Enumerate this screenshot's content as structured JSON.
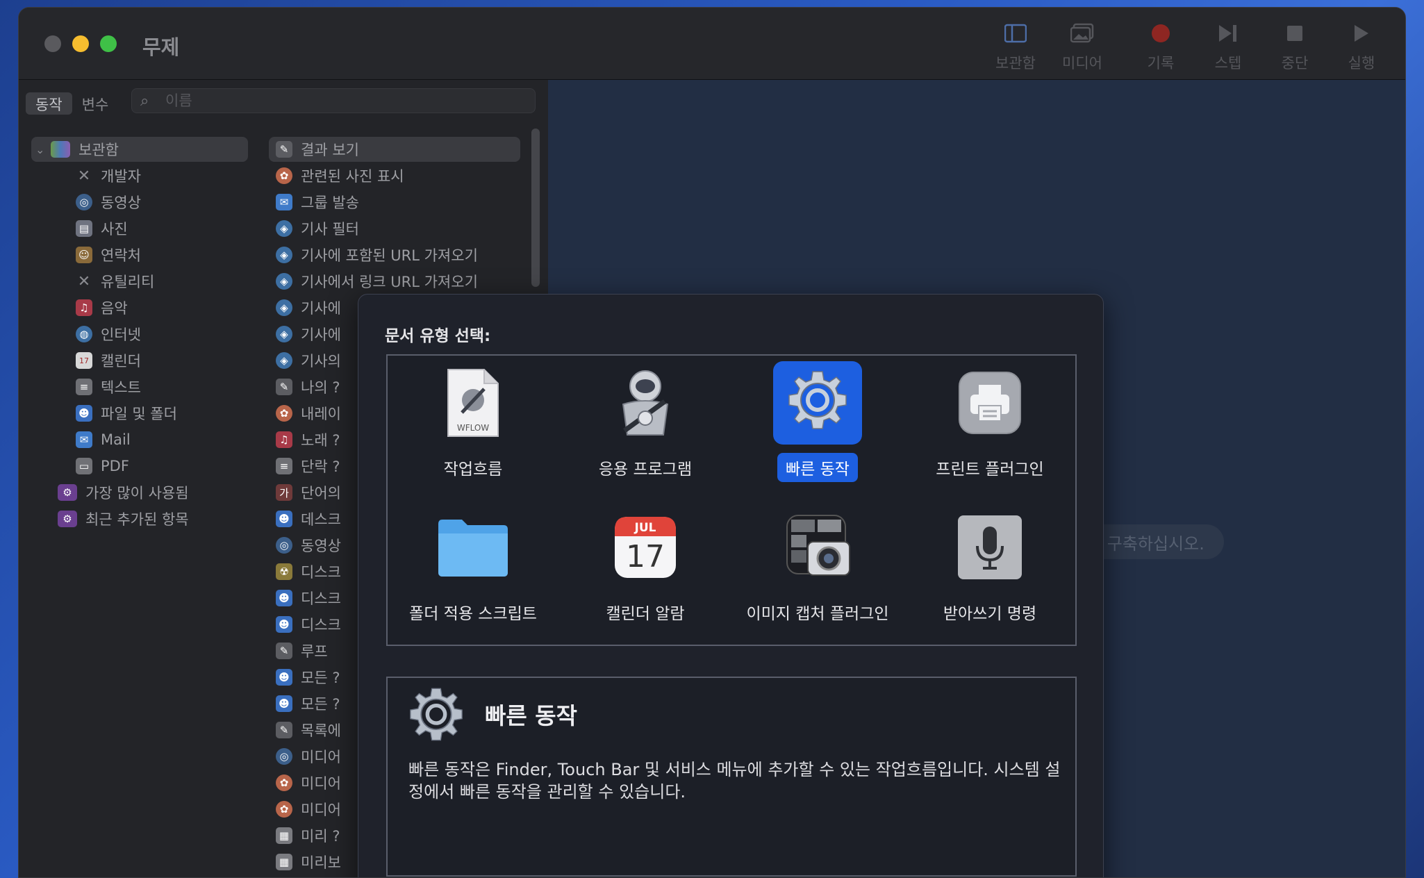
{
  "window": {
    "title": "무제"
  },
  "toolbar": {
    "items": [
      {
        "label": "보관함",
        "icon": "sidebar-icon"
      },
      {
        "label": "미디어",
        "icon": "photo-icon"
      },
      {
        "label": "기록",
        "icon": "record-icon"
      },
      {
        "label": "스텝",
        "icon": "step-icon"
      },
      {
        "label": "중단",
        "icon": "stop-icon"
      },
      {
        "label": "실행",
        "icon": "play-icon"
      }
    ]
  },
  "tabs": {
    "actions": "동작",
    "variables": "변수"
  },
  "search": {
    "placeholder": "이름",
    "value": ""
  },
  "library": {
    "root": "보관함",
    "items": [
      "개발자",
      "동영상",
      "사진",
      "연락처",
      "유틸리티",
      "음악",
      "인터넷",
      "캘린더",
      "텍스트",
      "파일 및 폴더",
      "Mail",
      "PDF"
    ],
    "most_used": "가장 많이 사용됨",
    "recently_added": "최근 추가된 항목"
  },
  "actions": [
    "결과 보기",
    "관련된 사진 표시",
    "그룹 발송",
    "기사 필터",
    "기사에 포함된 URL 가져오기",
    "기사에서 링크 URL 가져오기",
    "기사에",
    "기사에",
    "기사의",
    "나의 ?",
    "내레이",
    "노래 ?",
    "단락 ?",
    "단어의",
    "데스크",
    "동영상",
    "디스크",
    "디스크",
    "디스크",
    "루프",
    "모든 ?",
    "모든 ?",
    "목록에",
    "미디어",
    "미디어",
    "미디어",
    "미리 ?",
    "미리보"
  ],
  "canvas": {
    "hint": "을 구축하십시오."
  },
  "sheet": {
    "title": "문서 유형 선택:",
    "types": [
      {
        "label": "작업흐름",
        "icon": "workflow-document-icon",
        "badge": "WFLOW"
      },
      {
        "label": "응용 프로그램",
        "icon": "automator-robot-icon"
      },
      {
        "label": "빠른 동작",
        "icon": "gear-icon",
        "selected": true
      },
      {
        "label": "프린트 플러그인",
        "icon": "printer-icon"
      },
      {
        "label": "폴더 적용 스크립트",
        "icon": "folder-icon"
      },
      {
        "label": "캘린더 알람",
        "icon": "calendar-icon",
        "month": "JUL",
        "day": "17"
      },
      {
        "label": "이미지 캡처 플러그인",
        "icon": "camera-icon"
      },
      {
        "label": "받아쓰기 명령",
        "icon": "microphone-icon"
      }
    ],
    "description": {
      "title": "빠른 동작",
      "text": "빠른 동작은 Finder, Touch Bar 및 서비스 메뉴에 추가할 수 있는 작업흐름입니다. 시스템 설정에서 빠른 동작을 관리할 수 있습니다."
    }
  },
  "colors": {
    "accent": "#1d5fe0",
    "record": "#c8362f"
  }
}
